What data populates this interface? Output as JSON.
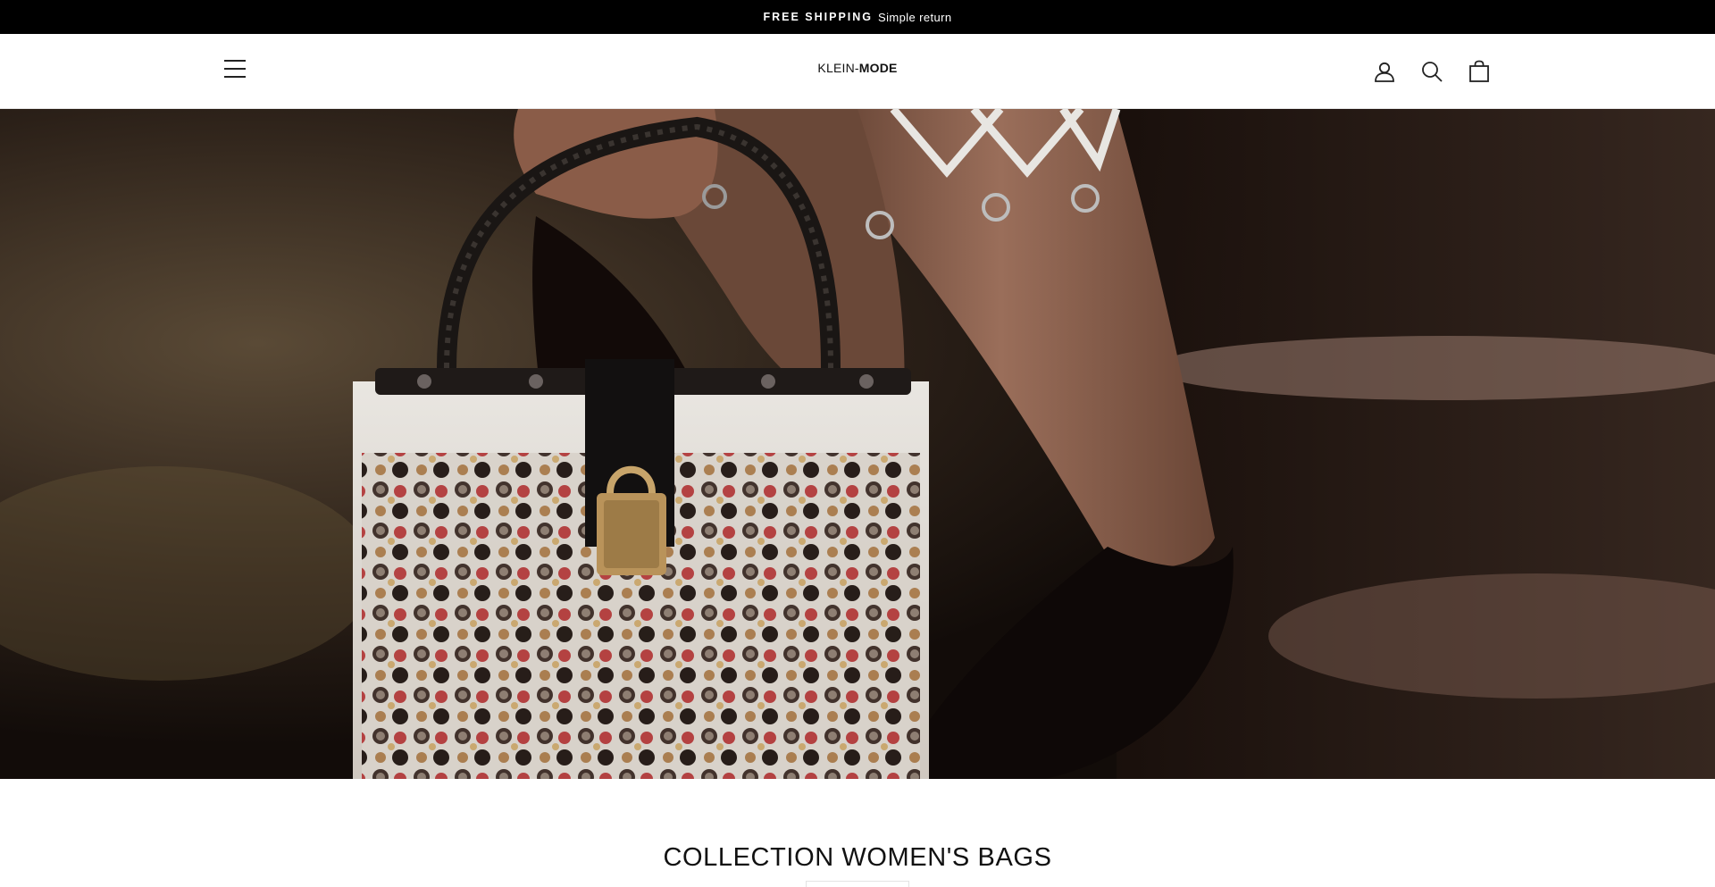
{
  "announcement": {
    "bold_text": "FREE SHIPPING",
    "text": "Simple return"
  },
  "header": {
    "menu_icon": "hamburger-menu-icon",
    "logo_part1": "KLEIN-",
    "logo_part2": "MODE",
    "account_icon": "user-icon",
    "search_icon": "search-icon",
    "cart_icon": "shopping-bag-icon"
  },
  "hero": {
    "image_subject": "Person holding a white embellished jeweled handbag with black handle and gold padlock"
  },
  "collection": {
    "title": "COLLECTION WOMEN'S BAGS"
  },
  "colors": {
    "announcement_bg": "#000000",
    "header_bg": "#ffffff",
    "text": "#111111"
  }
}
